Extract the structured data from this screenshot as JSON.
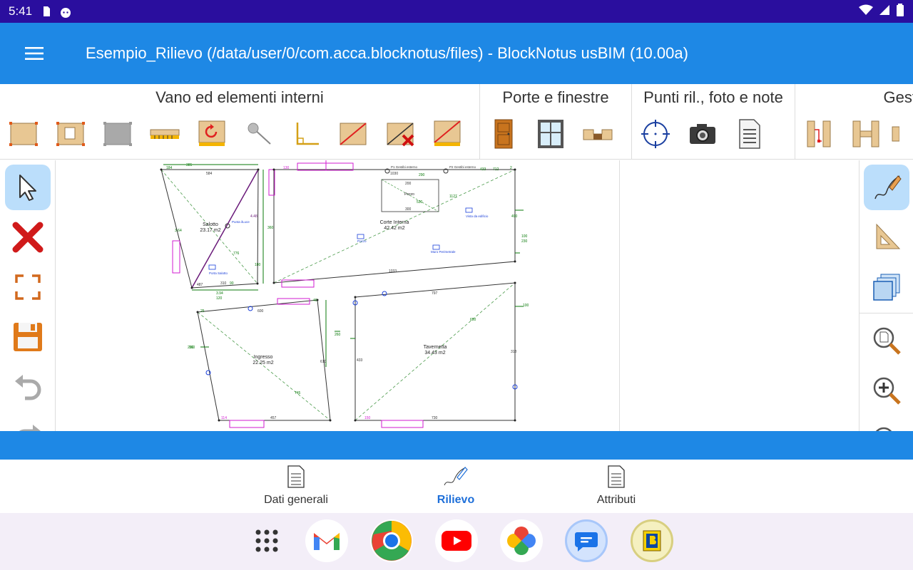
{
  "status_bar": {
    "time": "5:41"
  },
  "app_bar": {
    "title": "Esempio_Rilievo  (/data/user/0/com.acca.blocknotus/files) - BlockNotus   usBIM (10.00a)"
  },
  "ribbon": {
    "groups": [
      {
        "title": "Vano ed elementi interni"
      },
      {
        "title": "Porte e finestre"
      },
      {
        "title": "Punti ril., foto e note"
      },
      {
        "title": "Gest"
      }
    ]
  },
  "drawing": {
    "rooms": [
      {
        "name": "Salotto",
        "area": "23.17 m2"
      },
      {
        "name": "Corte Interna",
        "area": "42.42 m2"
      },
      {
        "name": "Ingresso",
        "area": "22.25 m2"
      },
      {
        "name": "Tavernetta",
        "area": "34.43 m2"
      },
      {
        "name": "Pozzo"
      }
    ],
    "points": [
      {
        "label": "P1 Gesti­bi esterno"
      },
      {
        "label": "P2 Gesti­bi esterno"
      }
    ],
    "notes": [
      {
        "label": "Porta Salotto"
      },
      {
        "label": "Pozzo"
      },
      {
        "label": "Muro Perimetrale"
      },
      {
        "label": "Vista da edificio"
      },
      {
        "label": "Punta ilLuce"
      }
    ],
    "dimensions": [
      "184",
      "385",
      "584",
      "130",
      "1030",
      "290",
      "2",
      "433",
      "712",
      "1127",
      "490",
      "530",
      "200",
      "300",
      "100",
      "230",
      "1033",
      "180",
      "310",
      "360",
      "487",
      "776",
      "25",
      "600",
      "40",
      "120",
      "260",
      "260",
      "150",
      "457",
      "797",
      "100",
      "650",
      "433",
      "318",
      "730",
      "160",
      "745",
      "114",
      "610",
      "3.94",
      "4.48",
      "3.64",
      "90"
    ]
  },
  "bottom_nav": {
    "items": [
      {
        "label": "Dati generali"
      },
      {
        "label": "Rilievo"
      },
      {
        "label": "Attributi"
      }
    ]
  },
  "colors": {
    "status_bar": "#2a0e9e",
    "app_bar": "#1e88e5",
    "active_tab": "#1e6fd9",
    "wall": "#333333",
    "dimension": "#0a7a0a",
    "opening": "#d21bd2",
    "note": "#1a3fd9"
  }
}
